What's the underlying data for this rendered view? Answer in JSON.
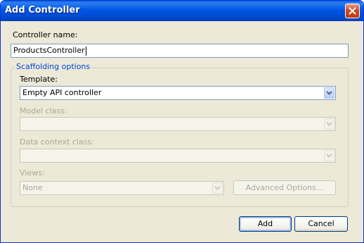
{
  "window": {
    "title": "Add Controller"
  },
  "controller_name": {
    "label": "Controller name:",
    "value": "ProductsController"
  },
  "scaffolding": {
    "group_title": "Scaffolding options",
    "template": {
      "label": "Template:",
      "value": "Empty API controller"
    },
    "model_class": {
      "label": "Model class:",
      "value": ""
    },
    "data_context_class": {
      "label": "Data context class:",
      "value": ""
    },
    "views": {
      "label": "Views:",
      "value": "None"
    },
    "advanced_options_label": "Advanced Options..."
  },
  "buttons": {
    "add_label": "Add",
    "cancel_label": "Cancel"
  },
  "colors": {
    "titlebar": "#0055e5",
    "group_title": "#0046d5",
    "disabled_text": "#aca899"
  }
}
